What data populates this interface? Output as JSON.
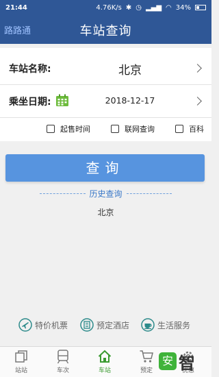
{
  "status_bar": {
    "time": "21:44",
    "speed": "4.76K/s",
    "battery": "34%"
  },
  "header": {
    "logo": "路路通",
    "title": "车站查询"
  },
  "form": {
    "station_label": "车站名称:",
    "station_value": "北京",
    "date_label": "乘坐日期:",
    "date_value": "2018-12-17",
    "options": [
      "起售时间",
      "联网查询",
      "百科"
    ]
  },
  "query_button": "查询",
  "history": {
    "title": "历史查询",
    "items": [
      "北京"
    ]
  },
  "services": [
    "特价机票",
    "预定酒店",
    "生活服务"
  ],
  "tabs": [
    "站站",
    "车次",
    "车站",
    "预定",
    "优惠"
  ],
  "active_tab": "车站",
  "watermark": {
    "icon_text": "安",
    "brand": "智"
  },
  "colors": {
    "header": "#2f5796",
    "button": "#5794df",
    "active_tab": "#3a9a30",
    "accent_link": "#3a78c8"
  }
}
